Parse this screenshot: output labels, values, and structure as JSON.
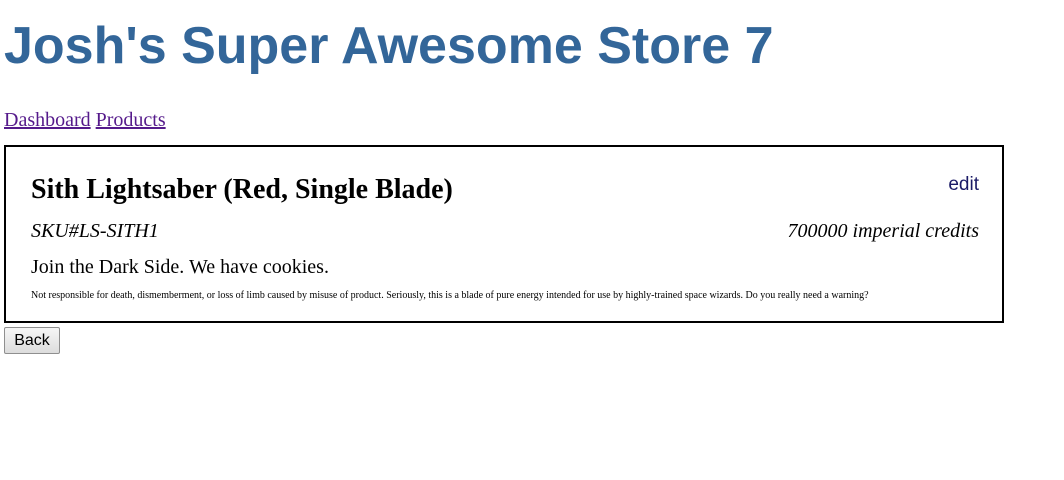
{
  "header": {
    "title": "Josh's Super Awesome Store 7",
    "title_color": "#336699"
  },
  "nav": {
    "links": [
      {
        "label": "Dashboard"
      },
      {
        "label": "Products"
      }
    ],
    "link_color": "#551a8b"
  },
  "product": {
    "name": "Sith Lightsaber (Red, Single Blade)",
    "edit_label": "edit",
    "sku": "SKU#LS-SITH1",
    "price": "700000 imperial credits",
    "description": "Join the Dark Side. We have cookies.",
    "disclaimer": "Not responsible for death, dismemberment, or loss of limb caused by misuse of product. Seriously, this is a blade of pure energy intended for use by highly-trained space wizards. Do you really need a warning?"
  },
  "actions": {
    "back_label": "Back"
  }
}
